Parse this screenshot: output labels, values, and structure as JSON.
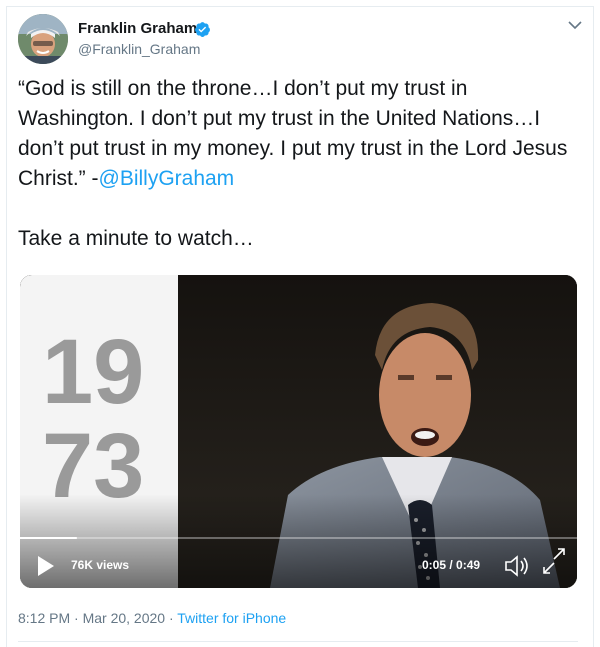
{
  "author": {
    "name": "Franklin Graham",
    "handle": "@Franklin_Graham",
    "verified": true
  },
  "tweet": {
    "quote_text": "“God is still on the throne…I don’t put my trust in Washington. I don’t put my trust in the United Nations…I don’t put trust in my money. I put my trust in the Lord Jesus Christ.” -",
    "mention": "@BillyGraham",
    "line2": "Take a minute to watch…"
  },
  "video": {
    "overlay_year_top": "19",
    "overlay_year_bottom": "73",
    "views": "76K views",
    "time": "0:05 / 0:49",
    "progress": 0.102
  },
  "meta": {
    "timestamp": "8:12 PM · Mar 20, 2020 · ",
    "source": "Twitter for iPhone"
  },
  "colors": {
    "link": "#1da1f2",
    "verified": "#1da1f2"
  },
  "icons": [
    "chevron-down-icon",
    "verified-badge-icon",
    "play-icon",
    "volume-icon",
    "fullscreen-icon"
  ]
}
